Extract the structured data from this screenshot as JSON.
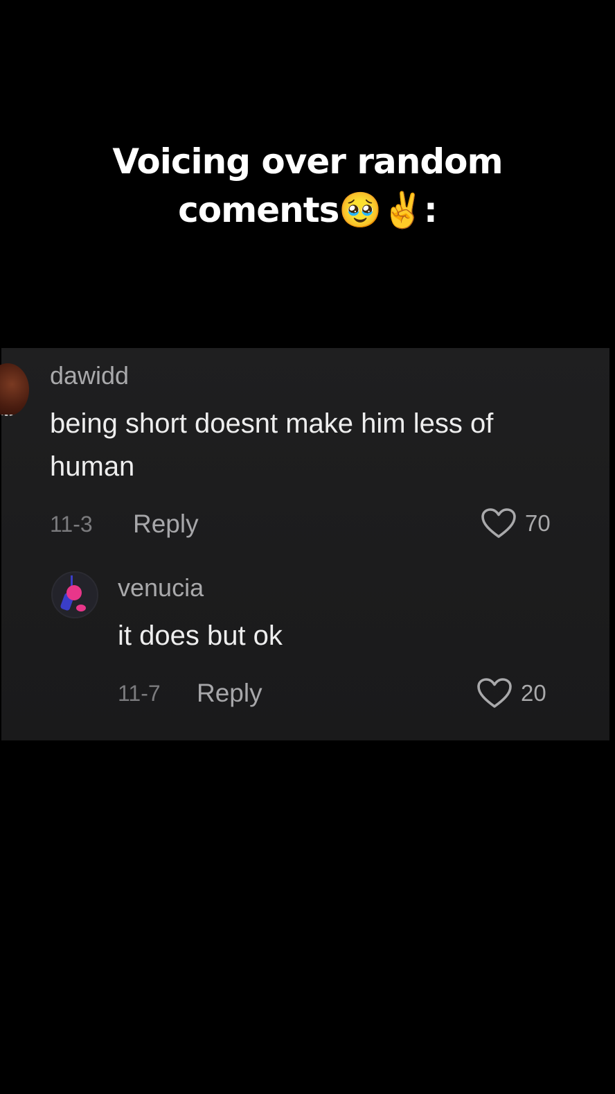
{
  "caption": {
    "line1": "Voicing over random",
    "line2": "coments🥹✌️:"
  },
  "comments": [
    {
      "username": "dawidd",
      "text_line1": "being short doesnt make him less of",
      "text_line2": "human",
      "date": "11-3",
      "reply_label": "Reply",
      "likes": "70"
    },
    {
      "username": "venucia",
      "text_line1": "it does but ok",
      "date": "11-7",
      "reply_label": "Reply",
      "likes": "20"
    }
  ],
  "icons": {
    "like": "heart-outline-icon"
  },
  "colors": {
    "background": "#000000",
    "panel": "#1e1e1f",
    "username": "#a9a9ab",
    "comment_text": "#eeeeee",
    "meta": "#7b7b7e"
  }
}
